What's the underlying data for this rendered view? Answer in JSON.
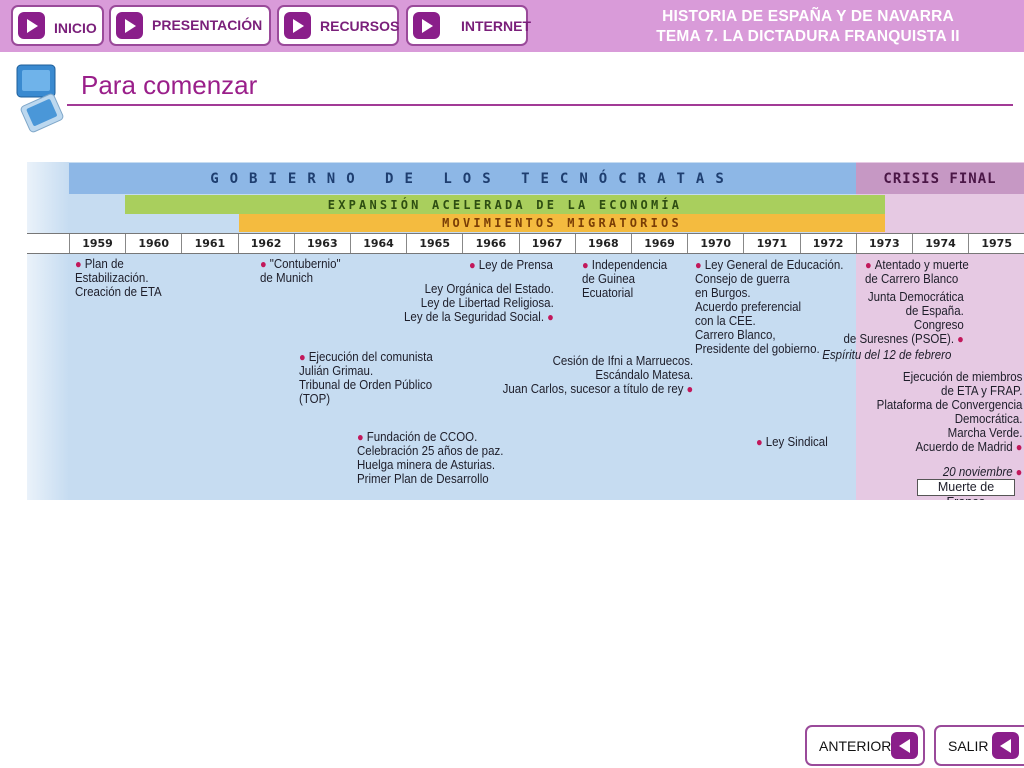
{
  "nav": {
    "inicio": "INICIO",
    "presentacion": "PRESENTACIÓN",
    "recursos": "RECURSOS",
    "internet": "INTERNET"
  },
  "course": {
    "line1": "HISTORIA DE ESPAÑA Y DE NAVARRA",
    "line2": "TEMA 7. LA DICTADURA FRANQUISTA II"
  },
  "section": {
    "title": "Para comenzar"
  },
  "timeline": {
    "bands": {
      "gobierno": "GOBIERNO DE LOS TECNÓCRATAS",
      "crisis": "CRISIS FINAL",
      "expansion": "EXPANSIÓN ACELERADA DE LA ECONOMÍA",
      "migraciones": "MOVIMIENTOS MIGRATORIOS"
    },
    "years": [
      "1959",
      "1960",
      "1961",
      "1962",
      "1963",
      "1964",
      "1965",
      "1966",
      "1967",
      "1968",
      "1969",
      "1970",
      "1971",
      "1972",
      "1973",
      "1974",
      "1975"
    ],
    "events": {
      "e1959": "Plan de\nEstabilización.\nCreación de ETA",
      "e1962": "\"Contubernio\"\nde Munich",
      "e1963": "Ejecución del comunista\nJulián Grimau.\nTribunal de Orden Público\n(TOP)",
      "e1964": "Fundación de CCOO.\nCelebración 25 años de paz.\nHuelga minera de Asturias.\nPrimer Plan de Desarrollo",
      "e1966a": "Ley de Prensa",
      "e1966b": "Ley Orgánica del Estado.\nLey de Libertad Religiosa.\nLey de la Seguridad Social.",
      "e1968": "Independencia\nde Guinea\nEcuatorial",
      "e1969": "Cesión de Ifni a Marruecos.\nEscándalo Matesa.\nJuan Carlos, sucesor a título de rey",
      "e1970": "Ley General de Educación.\nConsejo de guerra\nen Burgos.\nAcuerdo preferencial\ncon la CEE.\nCarrero Blanco,\nPresidente del gobierno.",
      "e1971": "Ley Sindical",
      "e1973": "Atentado y muerte\nde Carrero Blanco",
      "e1974a": "Junta Democrática\nde España.\nCongreso\nde Suresnes (PSOE).",
      "e1974b": "Espíritu del 12 de febrero",
      "e1975a": "Ejecución de miembros\nde ETA y FRAP.\nPlataforma de Convergencia\nDemocrática.\nMarcha Verde.\nAcuerdo de Madrid",
      "e1975b": "20 noviembre",
      "e1975c": "Muerte de Franco"
    }
  },
  "footer": {
    "anterior": "ANTERIOR",
    "salir": "SALIR"
  },
  "colors": {
    "topbar": "#d99bd9",
    "accent": "#8a1e8a",
    "title": "#9a1f8a",
    "gobierno_band": "#8db7e6",
    "crisis_band": "#c698c4",
    "expansion_band": "#a9cf5d",
    "migraciones_band": "#f4bb3f",
    "bullet": "#c2185b"
  }
}
